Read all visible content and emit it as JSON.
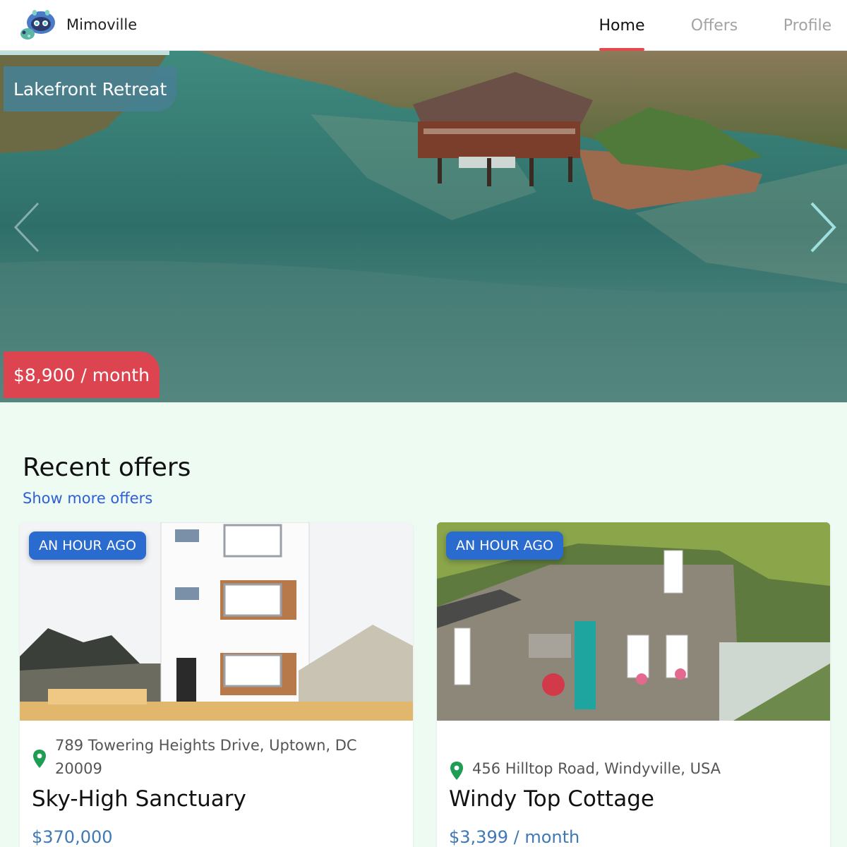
{
  "app": {
    "name": "Mimoville",
    "logo_icon": "mimoville-robot-logo"
  },
  "nav": {
    "items": [
      {
        "label": "Home",
        "active": true
      },
      {
        "label": "Offers",
        "active": false
      },
      {
        "label": "Profile",
        "active": false
      }
    ],
    "active_color": "#e5484d"
  },
  "hero": {
    "title": "Lakefront Retreat",
    "price": "$8,900 / month",
    "prev_icon": "chevron-left-icon",
    "next_icon": "chevron-right-icon"
  },
  "recent": {
    "heading": "Recent offers",
    "show_more": "Show more offers",
    "offers": [
      {
        "badge": "AN HOUR AGO",
        "address": "789 Towering Heights Drive, Uptown, DC 20009",
        "title": "Sky-High Sanctuary",
        "price": "$370,000"
      },
      {
        "badge": "AN HOUR AGO",
        "address": "456 Hilltop Road, Windyville, USA",
        "title": "Windy Top Cottage",
        "price": "$3,399 / month"
      }
    ]
  },
  "colors": {
    "badge": "#2a6bd0",
    "price_tag": "#dc4450",
    "pin": "#1f9d55",
    "background": "#eefbf3"
  }
}
